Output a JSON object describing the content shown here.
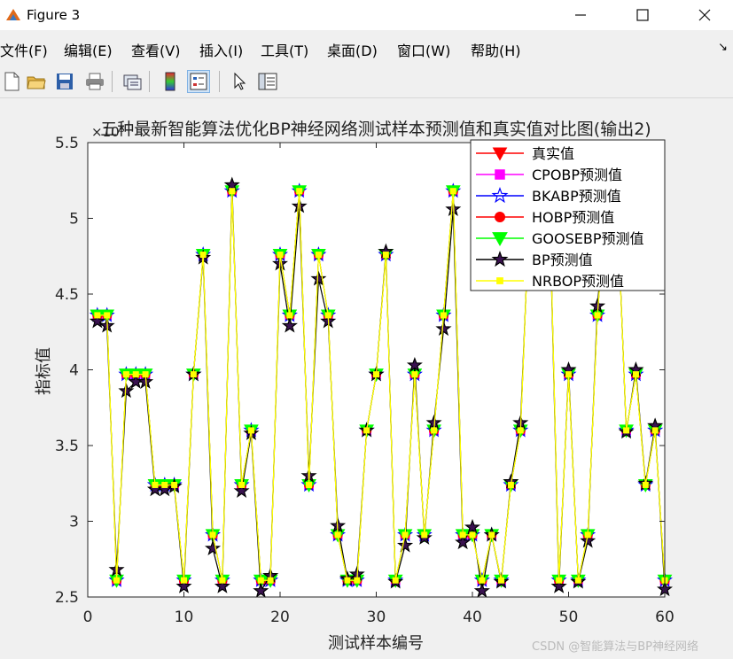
{
  "window": {
    "title": "Figure 3"
  },
  "menu": [
    "文件(F)",
    "编辑(E)",
    "查看(V)",
    "插入(I)",
    "工具(T)",
    "桌面(D)",
    "窗口(W)",
    "帮助(H)"
  ],
  "toolbar_icons": [
    "new-file-icon",
    "open-folder-icon",
    "save-icon",
    "print-icon",
    "link-icon",
    "colorbar-icon",
    "legend-icon",
    "pointer-icon",
    "property-editor-icon"
  ],
  "watermark": "CSDN @智能算法与BP神经网络",
  "chart_data": {
    "type": "line",
    "title": "五种最新智能算法优化BP神经网络测试样本预测值和真实值对比图(输出2)",
    "xlabel": "测试样本编号",
    "ylabel": "指标值",
    "scale_exponent": "×10⁵",
    "xlim": [
      0,
      60
    ],
    "ylim": [
      2.5,
      5.5
    ],
    "xticks": [
      0,
      10,
      20,
      30,
      40,
      50,
      60
    ],
    "yticks": [
      2.5,
      3,
      3.5,
      4,
      4.5,
      5,
      5.5
    ],
    "grid": false,
    "legend_position": "top-right",
    "x": [
      1,
      2,
      3,
      4,
      5,
      6,
      7,
      8,
      9,
      10,
      11,
      12,
      13,
      14,
      15,
      16,
      17,
      18,
      19,
      20,
      21,
      22,
      23,
      24,
      25,
      26,
      27,
      28,
      29,
      30,
      31,
      32,
      33,
      34,
      35,
      36,
      37,
      38,
      39,
      40,
      41,
      42,
      43,
      44,
      45,
      46,
      47,
      48,
      49,
      50,
      51,
      52,
      53,
      54,
      55,
      56,
      57,
      58,
      59,
      60
    ],
    "series": [
      {
        "name": "真实值",
        "color": "#ff0000",
        "marker": "triangle-down",
        "values": [
          4.36,
          4.36,
          2.61,
          3.97,
          3.97,
          3.97,
          3.24,
          3.24,
          3.24,
          2.61,
          3.97,
          4.76,
          2.91,
          2.61,
          5.18,
          3.24,
          3.6,
          2.61,
          2.61,
          4.76,
          4.36,
          5.18,
          3.24,
          4.76,
          4.36,
          2.91,
          2.61,
          2.61,
          3.6,
          3.97,
          4.76,
          2.61,
          2.91,
          3.97,
          2.91,
          3.6,
          4.36,
          5.18,
          2.91,
          2.91,
          2.61,
          2.91,
          2.61,
          3.24,
          3.6,
          5.18,
          5.18,
          5.18,
          2.61,
          3.97,
          2.61,
          2.91,
          4.36,
          5.18,
          5.18,
          3.6,
          3.97,
          3.24,
          3.6,
          2.61
        ]
      },
      {
        "name": "CPOBP预测值",
        "color": "#ff00ff",
        "marker": "square",
        "values": [
          4.36,
          4.36,
          2.61,
          3.97,
          3.97,
          3.97,
          3.24,
          3.24,
          3.24,
          2.61,
          3.97,
          4.76,
          2.91,
          2.61,
          5.18,
          3.24,
          3.6,
          2.61,
          2.61,
          4.76,
          4.36,
          5.18,
          3.24,
          4.76,
          4.36,
          2.91,
          2.61,
          2.61,
          3.6,
          3.97,
          4.76,
          2.61,
          2.91,
          3.97,
          2.91,
          3.6,
          4.36,
          5.18,
          2.91,
          2.91,
          2.61,
          2.91,
          2.61,
          3.24,
          3.6,
          5.18,
          5.18,
          5.18,
          2.61,
          3.97,
          2.61,
          2.91,
          4.36,
          5.18,
          5.18,
          3.6,
          3.97,
          3.24,
          3.6,
          2.61
        ]
      },
      {
        "name": "BKABP预测值",
        "color": "#0000ff",
        "marker": "star",
        "values": [
          4.36,
          4.36,
          2.61,
          3.97,
          3.97,
          3.97,
          3.24,
          3.24,
          3.24,
          2.61,
          3.97,
          4.76,
          2.91,
          2.61,
          5.18,
          3.24,
          3.6,
          2.61,
          2.61,
          4.76,
          4.36,
          5.18,
          3.24,
          4.76,
          4.36,
          2.91,
          2.61,
          2.61,
          3.6,
          3.97,
          4.76,
          2.61,
          2.91,
          3.97,
          2.91,
          3.6,
          4.36,
          5.18,
          2.91,
          2.91,
          2.61,
          2.91,
          2.61,
          3.24,
          3.6,
          5.18,
          5.18,
          5.18,
          2.61,
          3.97,
          2.61,
          2.91,
          4.36,
          5.18,
          5.18,
          3.6,
          3.97,
          3.24,
          3.6,
          2.61
        ]
      },
      {
        "name": "HOBP预测值",
        "color": "#ff0000",
        "marker": "circle",
        "values": [
          4.36,
          4.36,
          2.61,
          3.97,
          3.97,
          3.97,
          3.24,
          3.24,
          3.24,
          2.61,
          3.97,
          4.76,
          2.91,
          2.61,
          5.18,
          3.24,
          3.6,
          2.61,
          2.61,
          4.76,
          4.36,
          5.18,
          3.24,
          4.76,
          4.36,
          2.91,
          2.61,
          2.61,
          3.6,
          3.97,
          4.76,
          2.61,
          2.91,
          3.97,
          2.91,
          3.6,
          4.36,
          5.18,
          2.91,
          2.91,
          2.61,
          2.91,
          2.61,
          3.24,
          3.6,
          5.18,
          5.18,
          5.18,
          2.61,
          3.97,
          2.61,
          2.91,
          4.36,
          5.18,
          5.18,
          3.6,
          3.97,
          3.24,
          3.6,
          2.61
        ]
      },
      {
        "name": "GOOSEBP预测值",
        "color": "#00ff00",
        "marker": "triangle-down",
        "values": [
          4.36,
          4.36,
          2.61,
          3.97,
          3.97,
          3.97,
          3.24,
          3.24,
          3.24,
          2.61,
          3.97,
          4.76,
          2.91,
          2.61,
          5.18,
          3.24,
          3.6,
          2.61,
          2.61,
          4.76,
          4.36,
          5.18,
          3.24,
          4.76,
          4.36,
          2.91,
          2.61,
          2.61,
          3.6,
          3.97,
          4.76,
          2.61,
          2.91,
          3.97,
          2.91,
          3.6,
          4.36,
          5.18,
          2.91,
          2.91,
          2.61,
          2.91,
          2.61,
          3.24,
          3.6,
          5.18,
          5.18,
          5.18,
          2.61,
          3.97,
          2.61,
          2.91,
          4.36,
          5.18,
          5.18,
          3.6,
          3.97,
          3.24,
          3.6,
          2.61
        ]
      },
      {
        "name": "BP预测值",
        "color": "#000000",
        "marker": "star",
        "values": [
          4.32,
          4.29,
          2.68,
          3.86,
          3.92,
          3.92,
          3.21,
          3.21,
          3.23,
          2.57,
          3.97,
          4.74,
          2.82,
          2.57,
          5.22,
          3.2,
          3.58,
          2.54,
          2.64,
          4.7,
          4.29,
          5.08,
          3.3,
          4.6,
          4.32,
          2.97,
          2.62,
          2.65,
          3.6,
          3.97,
          4.78,
          2.6,
          2.84,
          4.03,
          2.89,
          3.65,
          4.27,
          5.06,
          2.86,
          2.96,
          2.54,
          2.91,
          2.6,
          3.26,
          3.65,
          5.15,
          5.16,
          5.14,
          2.57,
          4.0,
          2.6,
          2.87,
          4.42,
          5.15,
          5.2,
          3.59,
          4.0,
          3.25,
          3.63,
          2.55
        ]
      },
      {
        "name": "NRBOP预测值",
        "color": "#ffff00",
        "marker": "square",
        "values": [
          4.36,
          4.36,
          2.61,
          3.97,
          3.97,
          3.97,
          3.24,
          3.24,
          3.24,
          2.61,
          3.97,
          4.76,
          2.91,
          2.61,
          5.18,
          3.24,
          3.6,
          2.61,
          2.61,
          4.76,
          4.36,
          5.18,
          3.24,
          4.76,
          4.36,
          2.91,
          2.61,
          2.61,
          3.6,
          3.97,
          4.76,
          2.61,
          2.91,
          3.97,
          2.91,
          3.6,
          4.36,
          5.18,
          2.91,
          2.91,
          2.61,
          2.91,
          2.61,
          3.24,
          3.6,
          5.18,
          5.18,
          5.18,
          2.61,
          3.97,
          2.61,
          2.91,
          4.36,
          5.18,
          5.18,
          3.6,
          3.97,
          3.24,
          3.6,
          2.61
        ]
      }
    ]
  }
}
